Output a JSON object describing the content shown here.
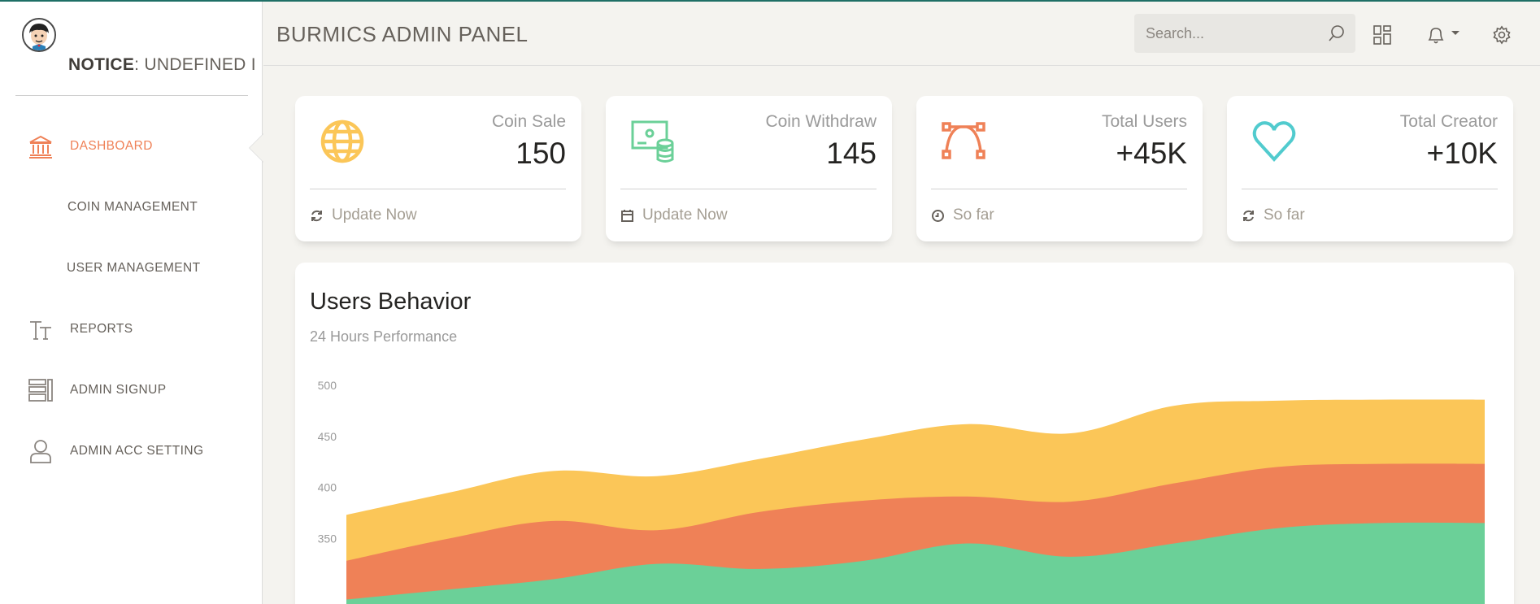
{
  "sidebar": {
    "logo": {
      "notice_bold": "NOTICE",
      "notice_rest": ": UNDEFINED I"
    },
    "items": [
      {
        "label": "DASHBOARD",
        "icon": "bank-icon",
        "active": true
      },
      {
        "label": "COIN MANAGEMENT",
        "icon": "",
        "active": false
      },
      {
        "label": "USER MANAGEMENT",
        "icon": "",
        "active": false
      },
      {
        "label": "REPORTS",
        "icon": "text-size-icon",
        "active": false
      },
      {
        "label": "ADMIN SIGNUP",
        "icon": "layout-list-icon",
        "active": false
      },
      {
        "label": "ADMIN ACC SETTING",
        "icon": "user-icon",
        "active": false
      }
    ]
  },
  "header": {
    "brand": "BURMICS ADMIN PANEL",
    "search_placeholder": "Search...",
    "icons": [
      "search-icon",
      "grid-icon",
      "bell-icon",
      "gear-icon"
    ]
  },
  "stats": [
    {
      "category": "Coin Sale",
      "value": "150",
      "footer": "Update Now",
      "icon": "globe-icon",
      "footer_icon": "refresh-icon",
      "color": "#fbc658"
    },
    {
      "category": "Coin Withdraw",
      "value": "145",
      "footer": "Update Now",
      "icon": "money-coins-icon",
      "footer_icon": "calendar-icon",
      "color": "#6bd098"
    },
    {
      "category": "Total Users",
      "value": "+45K",
      "footer": "So far",
      "icon": "vector-icon",
      "footer_icon": "clock-icon",
      "color": "#ef8157"
    },
    {
      "category": "Total Creator",
      "value": "+10K",
      "footer": "So far",
      "icon": "heart-icon",
      "footer_icon": "refresh-icon",
      "color": "#51cbce"
    }
  ],
  "chart": {
    "title": "Users Behavior",
    "subtitle": "24 Hours Performance"
  },
  "chart_data": {
    "type": "area",
    "title": "Users Behavior",
    "subtitle": "24 Hours Performance",
    "ylim": [
      300,
      500
    ],
    "yticks": [
      500,
      450,
      400,
      350
    ],
    "x": [
      0,
      1,
      2,
      3,
      4,
      5,
      6,
      7,
      8,
      9,
      10,
      11
    ],
    "grid": false,
    "series": [
      {
        "color": "#fbc658",
        "values": [
          373,
          395,
          416,
          411,
          428,
          447,
          462,
          453,
          480,
          485,
          486,
          486
        ]
      },
      {
        "color": "#ef8157",
        "values": [
          328,
          350,
          367,
          358,
          376,
          387,
          391,
          386,
          404,
          420,
          423,
          423
        ]
      },
      {
        "color": "#6bd098",
        "values": [
          290,
          300,
          310,
          325,
          320,
          328,
          345,
          332,
          345,
          360,
          365,
          365
        ]
      }
    ],
    "colors": {
      "accent": "#ef8157",
      "yellow": "#fbc658",
      "green": "#6bd098",
      "teal": "#51cbce"
    }
  }
}
